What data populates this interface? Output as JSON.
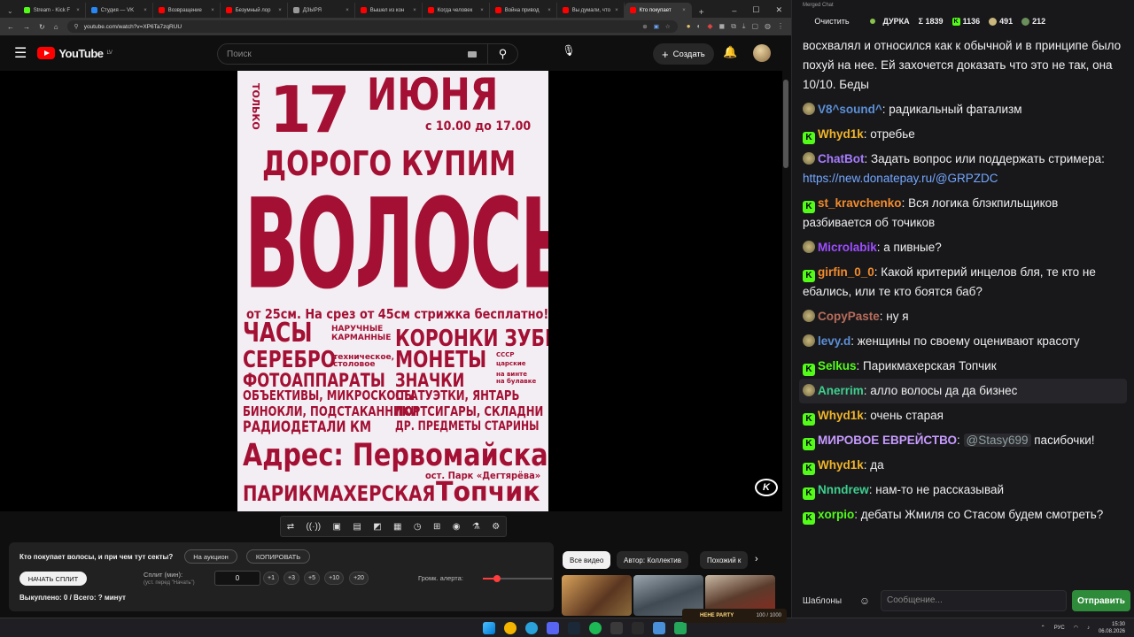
{
  "browser": {
    "tabs": [
      {
        "label": "Stream - Kick F",
        "color": "#53fc18"
      },
      {
        "label": "Студия — VK",
        "color": "#2787f5"
      },
      {
        "label": "Возвращение",
        "color": "#ff0000"
      },
      {
        "label": "Безумный лор",
        "color": "#ff0000"
      },
      {
        "label": "ДЗЫРЯ",
        "color": "#999999"
      },
      {
        "label": "Вышел из кон",
        "color": "#ff0000"
      },
      {
        "label": "Когда человек",
        "color": "#ff0000"
      },
      {
        "label": "Война привод",
        "color": "#ff0000"
      },
      {
        "label": "Вы думали, что",
        "color": "#ff0000"
      },
      {
        "label": "Кто покупает",
        "color": "#ff0000"
      }
    ],
    "url": "youtube.com/watch?v=XP6Ta7zqRUU"
  },
  "youtube": {
    "logo_text": "YouTube",
    "region": "LV",
    "search_placeholder": "Поиск",
    "create_label": "Создать"
  },
  "poster": {
    "only": "ТОЛЬКО",
    "date_num": "17",
    "date_month": "ИЮНЯ",
    "time": "с 10.00 до 17.00",
    "buy": "ДОРОГО КУПИМ",
    "hair": "ВОЛОСЫ",
    "length": "от 25см. На срез от 45см стрижка бесплатно!!!",
    "left_items": [
      "ЧАСЫ",
      "СЕРЕБРО",
      "ФОТОАППАРАТЫ",
      "ОБЪЕКТИВЫ, МИКРОСКОПЫ",
      "БИНОКЛИ, ПОДСТАКАННИКИ",
      "РАДИОДЕТАЛИ КМ"
    ],
    "left_notes": [
      "НАРУЧНЫЕ",
      "КАРМАННЫЕ",
      "техническое,",
      "столовое"
    ],
    "right_items": [
      "КОРОНКИ ЗУБНЫЕ",
      "МОНЕТЫ",
      "ЗНАЧКИ",
      "СТАТУЭТКИ, ЯНТАРЬ",
      "ПОРТСИГАРЫ, СКЛАДНИ",
      "ДР. ПРЕДМЕТЫ СТАРИНЫ"
    ],
    "right_notes": [
      "СССР",
      "царские",
      "на винте",
      "на булавке"
    ],
    "address": "Адрес: Первомайская 27",
    "park": "ост. Парк «Дегтярёва»",
    "salon": "ПАРИКМАХЕРСКАЯ",
    "name": "Топчик"
  },
  "video_tools": [
    "⇄",
    "((·))",
    "▣",
    "▤",
    "◩",
    "▦",
    "◷",
    "⊞",
    "◉",
    "⚗",
    "⚙"
  ],
  "split_panel": {
    "question": "Кто покупает волосы, и при чем тут секты?",
    "auction_label": "На аукцион",
    "copy_label": "КОПИРОВАТЬ",
    "start_label": "НАЧАТЬ СПЛИТ",
    "split_label": "Сплит (мин):",
    "split_hint": "(уст. перед \"Начать\")",
    "split_value": "0",
    "increments": [
      "+1",
      "+3",
      "+5",
      "+10",
      "+20"
    ],
    "volume_label": "Громк. алерта:",
    "volume_level": 0.2,
    "bought": "Выкуплено: 0 / Всего: ? минут"
  },
  "chips": [
    "Все видео",
    "Автор: Коллектив",
    "Похожий к"
  ],
  "party_label": "НЕНЕ PARTY",
  "party_count": "100 / 1000",
  "chat": {
    "title": "Merged Chat",
    "clear_label": "Очистить",
    "stats": {
      "mode": "ДУРКА",
      "sum": "Σ 1839",
      "kick": "1136",
      "twitch": "491",
      "other": "212"
    },
    "messages": [
      {
        "src": "none",
        "user": "",
        "color": "#efeff1",
        "text": "восхвалял и относился как к обычной и в принципе было похуй на нее. Ей захочется доказать что это не так, она 10/10. Беды"
      },
      {
        "src": "tw",
        "user": "V8^sound^",
        "color": "#5b8fd6",
        "text": "радикальный фатализм"
      },
      {
        "src": "kick",
        "user": "Whyd1k",
        "color": "#f0b429",
        "text": "отребье"
      },
      {
        "src": "tw",
        "user": "ChatBot",
        "color": "#a77cff",
        "text": "Задать вопрос или поддержать стримера: ",
        "link": "https://new.donatepay.ru/@GRPZDC"
      },
      {
        "src": "kick",
        "user": "st_kravchenko",
        "color": "#f28b2c",
        "text": "Вся логика блэкпильщиков разбивается об точиков"
      },
      {
        "src": "tw",
        "user": "Microlabik",
        "color": "#9d4dff",
        "text": " а пивные?"
      },
      {
        "src": "kick",
        "user": "girfin_0_0",
        "color": "#f28b2c",
        "text": "Какой критерий инцелов бля, те кто не ебались, или те кто боятся баб?"
      },
      {
        "src": "tw",
        "user": "CopyPaste",
        "color": "#b86c5a",
        "text": "ну я"
      },
      {
        "src": "tw",
        "user": "levy.d",
        "color": "#5b8fd6",
        "text": "женщины по своему оценивают красоту"
      },
      {
        "src": "kick",
        "user": "Selkus",
        "color": "#53fc18",
        "text": "Парикмахерская Топчик"
      },
      {
        "src": "tw",
        "user": "Anerrim",
        "color": "#3ecf8e",
        "text": "алло волосы да да бизнес",
        "hl": true
      },
      {
        "src": "kick",
        "user": "Whyd1k",
        "color": "#f0b429",
        "text": "очень старая"
      },
      {
        "src": "kick",
        "user": "МИРОВОЕ ЕВРЕЙСТВО",
        "color": "#c79bff",
        "text": "",
        "mention": "@Stasy699",
        "tail": " пасибочки!"
      },
      {
        "src": "kick",
        "user": "Whyd1k",
        "color": "#f0b429",
        "text": "да"
      },
      {
        "src": "kick",
        "user": "Nnndrew",
        "color": "#3ecf8e",
        "text": "нам-то не рассказывай"
      },
      {
        "src": "kick",
        "user": "xorpio",
        "color": "#53fc18",
        "text": "дебаты Жмиля со Стасом будем смотреть?"
      }
    ],
    "templates_label": "Шаблоны",
    "input_placeholder": "Сообщение...",
    "send_label": "Отправить"
  },
  "taskbar": {
    "lang": "РУС",
    "time": "15:30",
    "date": "06.08.2026"
  }
}
